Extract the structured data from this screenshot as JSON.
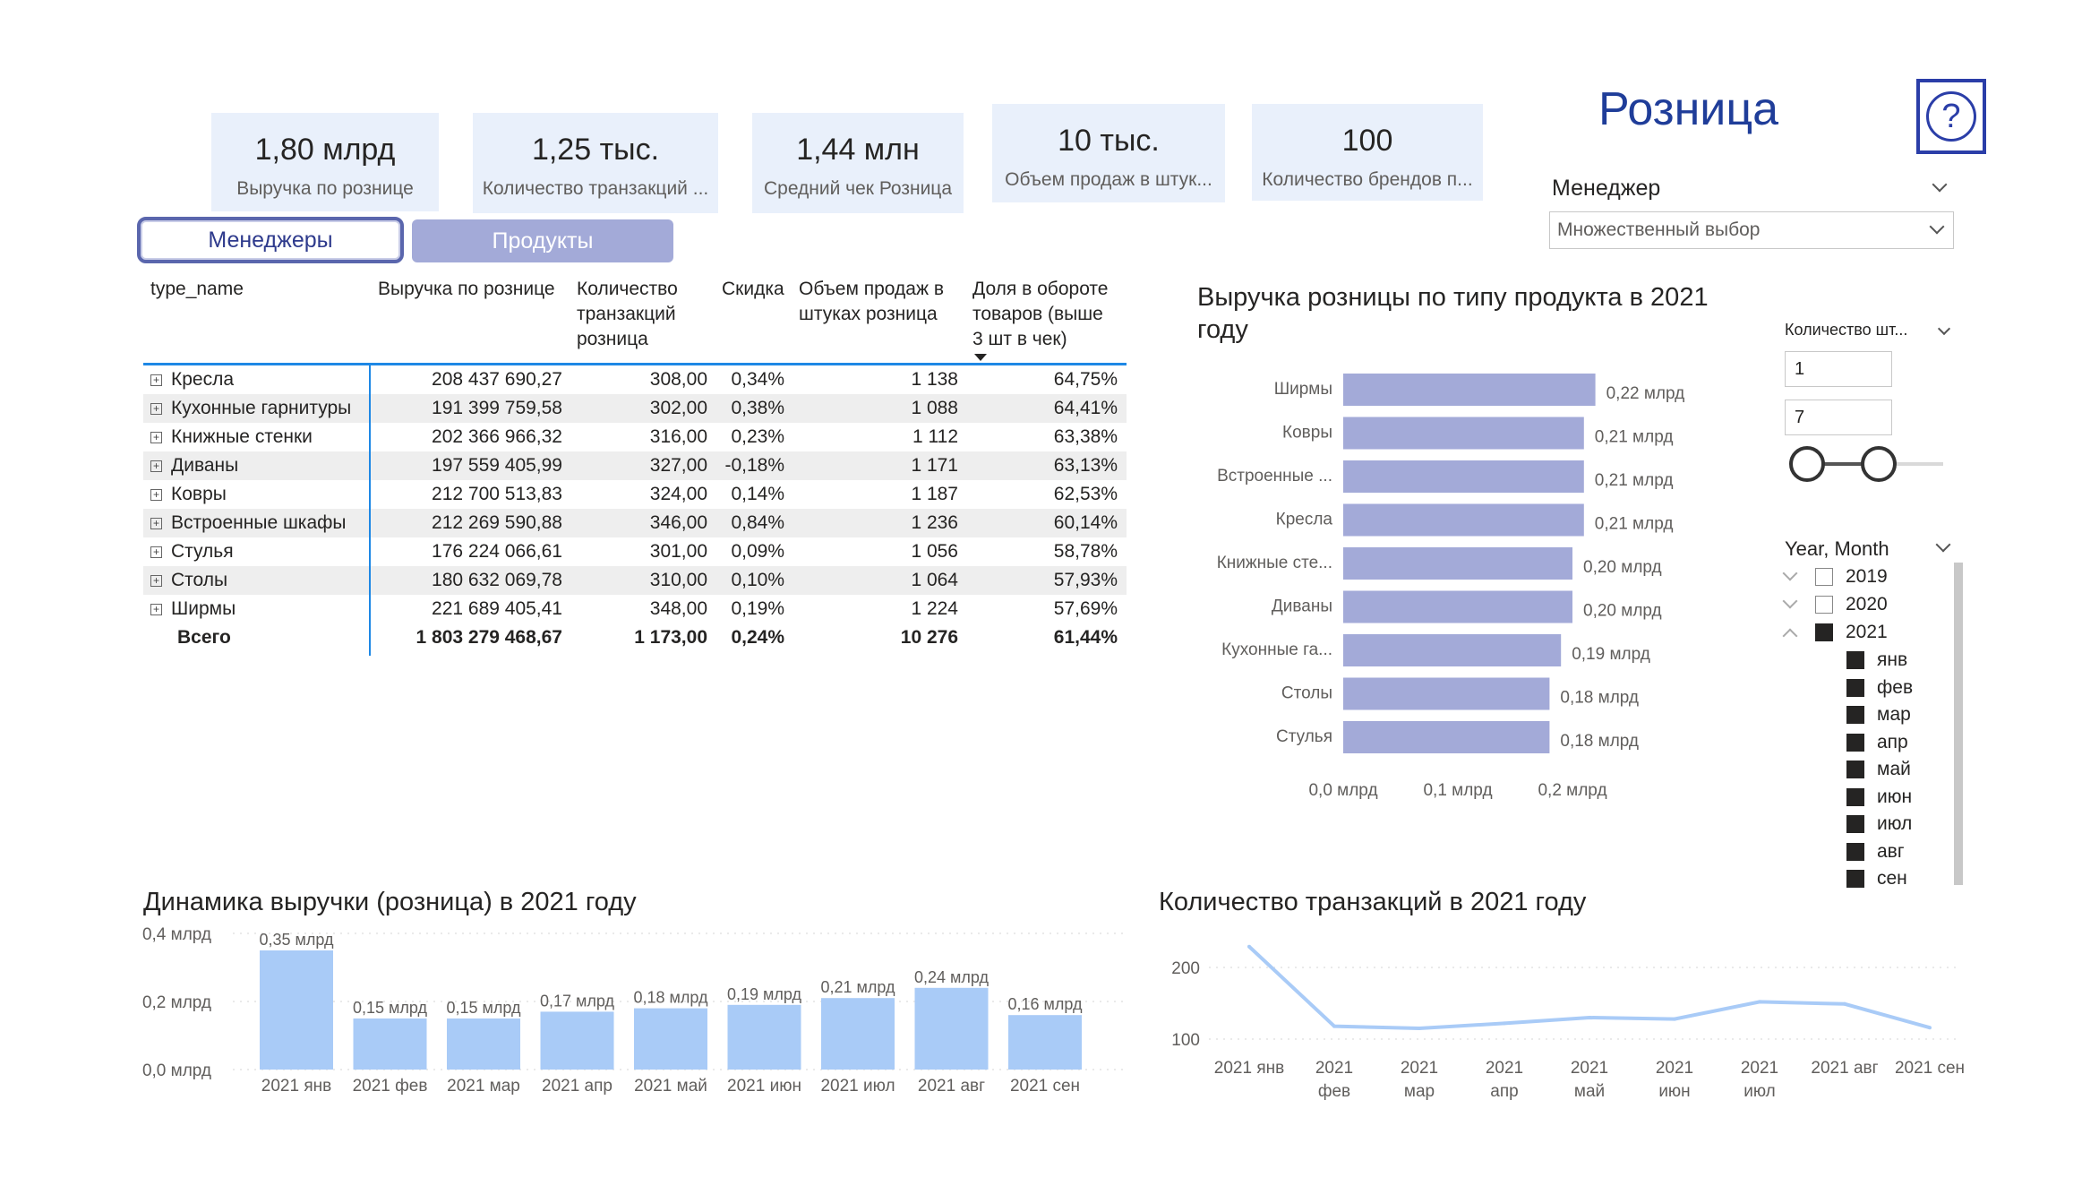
{
  "kpis": [
    {
      "value": "1,80 млрд",
      "label": "Выручка по рознице"
    },
    {
      "value": "1,25 тыс.",
      "label": "Количество транзакций ..."
    },
    {
      "value": "1,44 млн",
      "label": "Средний чек Розница"
    },
    {
      "value": "10 тыс.",
      "label": "Объем продаж в штук..."
    },
    {
      "value": "100",
      "label": "Количество брендов п..."
    }
  ],
  "page_title": "Розница",
  "help_label": "?",
  "tabs": {
    "managers": "Менеджеры",
    "products": "Продукты"
  },
  "table": {
    "headers": [
      "type_name",
      "Выручка по рознице",
      "Количество\nтранзакций\nрозница",
      "Скидка",
      "Объем продаж в\nштуках розница",
      "Доля в обороте\nтоваров (выше\n3 шт в чек)"
    ],
    "rows": [
      [
        "Кресла",
        "208 437 690,27",
        "308,00",
        "0,34%",
        "1 138",
        "64,75%"
      ],
      [
        "Кухонные гарнитуры",
        "191 399 759,58",
        "302,00",
        "0,38%",
        "1 088",
        "64,41%"
      ],
      [
        "Книжные стенки",
        "202 366 966,32",
        "316,00",
        "0,23%",
        "1 112",
        "63,38%"
      ],
      [
        "Диваны",
        "197 559 405,99",
        "327,00",
        "-0,18%",
        "1 171",
        "63,13%"
      ],
      [
        "Ковры",
        "212 700 513,83",
        "324,00",
        "0,14%",
        "1 187",
        "62,53%"
      ],
      [
        "Встроенные шкафы",
        "212 269 590,88",
        "346,00",
        "0,84%",
        "1 236",
        "60,14%"
      ],
      [
        "Стулья",
        "176 224 066,61",
        "301,00",
        "0,09%",
        "1 056",
        "58,78%"
      ],
      [
        "Столы",
        "180 632 069,78",
        "310,00",
        "0,10%",
        "1 064",
        "57,93%"
      ],
      [
        "Ширмы",
        "221 689 405,41",
        "348,00",
        "0,19%",
        "1 224",
        "57,69%"
      ]
    ],
    "total": [
      "Всего",
      "1 803 279 468,67",
      "1 173,00",
      "0,24%",
      "10 276",
      "61,44%"
    ]
  },
  "slicers": {
    "manager_title": "Менеджер",
    "manager_value": "Множественный выбор",
    "qty_title": "Количество шт...",
    "qty_min": "1",
    "qty_max": "7",
    "ym_title": "Year, Month",
    "years": [
      {
        "label": "2019",
        "checked": false
      },
      {
        "label": "2020",
        "checked": false
      },
      {
        "label": "2021",
        "checked": true
      }
    ],
    "months": [
      "янв",
      "фев",
      "мар",
      "апр",
      "май",
      "июн",
      "июл",
      "авг",
      "сен"
    ]
  },
  "chart_data": [
    {
      "type": "bar",
      "orientation": "horizontal",
      "title": "Выручка розницы по типу продукта в 2021 году",
      "categories": [
        "Ширмы",
        "Ковры",
        "Встроенные ...",
        "Кресла",
        "Книжные сте...",
        "Диваны",
        "Кухонные га...",
        "Столы",
        "Стулья"
      ],
      "values": [
        0.22,
        0.21,
        0.21,
        0.21,
        0.2,
        0.2,
        0.19,
        0.18,
        0.18
      ],
      "value_labels": [
        "0,22 млрд",
        "0,21 млрд",
        "0,21 млрд",
        "0,21 млрд",
        "0,20 млрд",
        "0,20 млрд",
        "0,19 млрд",
        "0,18 млрд",
        "0,18 млрд"
      ],
      "xticks": [
        "0,0 млрд",
        "0,1 млрд",
        "0,2 млрд"
      ],
      "xlim": [
        0,
        0.25
      ],
      "color": "#a3aad8"
    },
    {
      "type": "bar",
      "title": "Динамика выручки (розница) в 2021 году",
      "categories": [
        "2021 янв",
        "2021 фев",
        "2021 мар",
        "2021 апр",
        "2021 май",
        "2021 июн",
        "2021 июл",
        "2021 авг",
        "2021 сен"
      ],
      "values": [
        0.35,
        0.15,
        0.15,
        0.17,
        0.18,
        0.19,
        0.21,
        0.24,
        0.16
      ],
      "value_labels": [
        "0,35 млрд",
        "0,15 млрд",
        "0,15 млрд",
        "0,17 млрд",
        "0,18 млрд",
        "0,19 млрд",
        "0,21 млрд",
        "0,24 млрд",
        "0,16 млрд"
      ],
      "yticks": [
        "0,4 млрд",
        "0,2 млрд",
        "0,0 млрд"
      ],
      "ylim": [
        0,
        0.4
      ],
      "color": "#a9cbf7"
    },
    {
      "type": "line",
      "title": "Количество транзакций в 2021 году",
      "categories": [
        "2021 янв",
        "2021 фев",
        "2021 мар",
        "2021 апр",
        "2021 май",
        "2021 июн",
        "2021 июл",
        "2021 авг",
        "2021 сен"
      ],
      "category_lines": [
        [
          "2021 янв"
        ],
        [
          "2021",
          "фев"
        ],
        [
          "2021",
          "мар"
        ],
        [
          "2021",
          "апр"
        ],
        [
          "2021",
          "май"
        ],
        [
          "2021",
          "июн"
        ],
        [
          "2021",
          "июл"
        ],
        [
          "2021 авг"
        ],
        [
          "2021 сен"
        ]
      ],
      "values": [
        229,
        118,
        115,
        122,
        130,
        128,
        152,
        149,
        116
      ],
      "yticks": [
        "200",
        "100"
      ],
      "ylim": [
        70,
        240
      ],
      "color": "#a9cbf7"
    }
  ]
}
